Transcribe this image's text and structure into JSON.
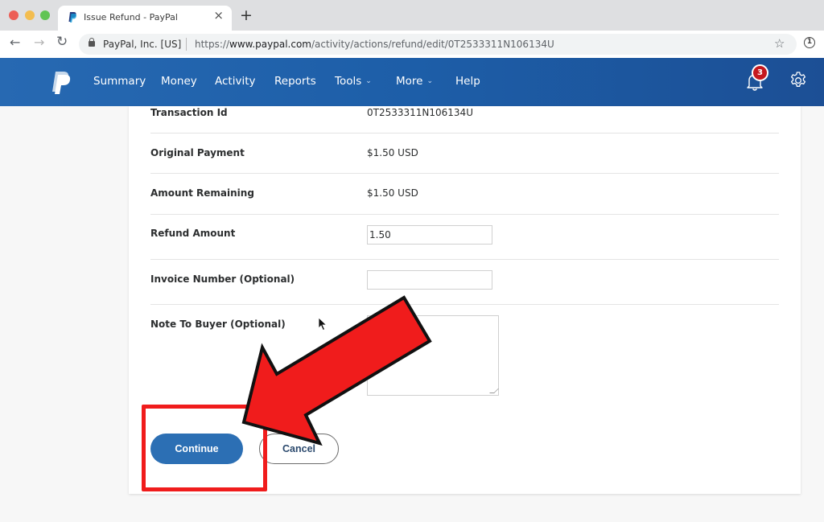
{
  "browser": {
    "tab": {
      "title": "Issue Refund - PayPal",
      "close_icon": "×",
      "favicon": "paypal-favicon"
    },
    "new_tab_icon": "+",
    "nav": {
      "back_icon": "←",
      "forward_icon": "→",
      "reload_icon": "↻"
    },
    "address_bar": {
      "site_identity": "PayPal, Inc. [US]",
      "url_prefix": "https://",
      "url_host": "www.paypal.com",
      "url_path": "/activity/actions/refund/edit/0T2533311N106134U"
    },
    "bookmark_icon": "☆",
    "extension_icon": "1"
  },
  "header": {
    "logo": "paypal-logo",
    "nav_items": [
      {
        "label": "Summary",
        "has_dropdown": false
      },
      {
        "label": "Money",
        "has_dropdown": false
      },
      {
        "label": "Activity",
        "has_dropdown": false
      },
      {
        "label": "Reports",
        "has_dropdown": false
      },
      {
        "label": "Tools",
        "has_dropdown": true
      },
      {
        "label": "More",
        "has_dropdown": true
      },
      {
        "label": "Help",
        "has_dropdown": false
      }
    ],
    "dropdown_chevron": "⌄",
    "notifications_count": "3",
    "colors": {
      "header_blue": "#1d5ea8",
      "badge_red": "#c5181e"
    }
  },
  "form": {
    "rows": [
      {
        "label": "Transaction Id",
        "value": "0T2533311N106134U"
      },
      {
        "label": "Original Payment",
        "value": "$1.50 USD"
      },
      {
        "label": "Amount Remaining",
        "value": "$1.50 USD"
      }
    ],
    "refund_amount": {
      "label": "Refund Amount",
      "value": "1.50"
    },
    "invoice_number": {
      "label": "Invoice Number (Optional)",
      "value": ""
    },
    "note_to_buyer": {
      "label": "Note To Buyer (Optional)",
      "value": ""
    },
    "continue_label": "Continue",
    "cancel_label": "Cancel",
    "colors": {
      "primary_button": "#2c6fb4"
    }
  },
  "annotation": {
    "arrow_color": "#f01c1c",
    "highlight_color": "#f01c1c"
  }
}
